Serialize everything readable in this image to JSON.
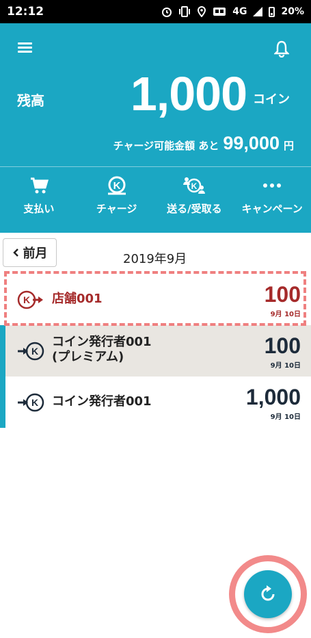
{
  "status_bar": {
    "time": "12:12",
    "network": "4G",
    "battery": "20%",
    "icons": [
      "alarm-icon",
      "vibrate-icon",
      "location-icon",
      "tv-icon",
      "signal-icon",
      "battery-icon"
    ]
  },
  "header": {
    "balance_label": "残高",
    "balance_value": "1,000",
    "balance_unit": "コイン",
    "charge_label": "チャージ可能金額 あと",
    "charge_value": "99,000",
    "charge_unit": "円"
  },
  "nav": [
    {
      "label": "支払い",
      "icon": "cart-icon"
    },
    {
      "label": "チャージ",
      "icon": "coin-charge-icon"
    },
    {
      "label": "送る/受取る",
      "icon": "send-receive-icon"
    },
    {
      "label": "キャンペーン",
      "icon": "more-dots-icon"
    }
  ],
  "month": {
    "prev_label": "前月",
    "title": "2019年9月"
  },
  "transactions": [
    {
      "name": "店舗001",
      "amount": "100",
      "date": "9月 10日"
    },
    {
      "name_line1": "コイン発行者001",
      "name_line2": "(プレミアム)",
      "amount": "100",
      "date": "9月 10日"
    },
    {
      "name": "コイン発行者001",
      "amount": "1,000",
      "date": "9月 10日"
    }
  ],
  "colors": {
    "primary": "#1ba7c3",
    "store_red": "#a52a2a",
    "highlight": "#ef8080",
    "row_grey": "#e9e6e1"
  }
}
